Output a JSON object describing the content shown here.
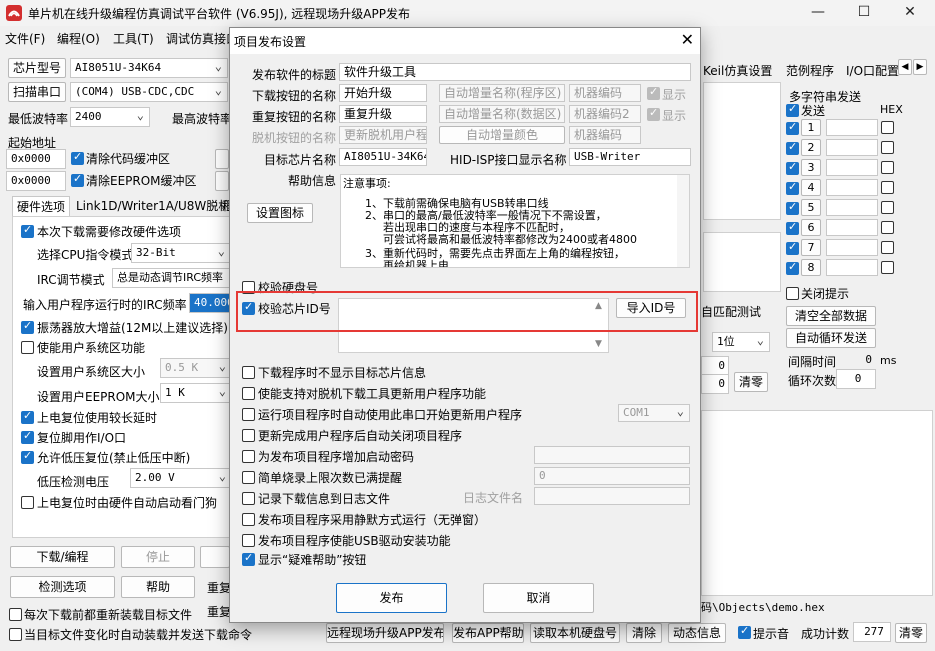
{
  "window": {
    "title": "单片机在线升级编程仿真调试平台软件 (V6.95J), 远程现场升级APP发布",
    "controls": [
      "—",
      "☐",
      "✕"
    ]
  },
  "menu": [
    "文件(F)",
    "编程(O)",
    "工具(T)",
    "调试仿真接口"
  ],
  "left": {
    "chip_type_btn": "芯片型号",
    "chip_type_val": "AI8051U-34K64",
    "scan_port_btn": "扫描串口",
    "port_val": "(COM4) USB-CDC,CDC",
    "min_baud_label": "最低波特率",
    "min_baud_val": "2400",
    "max_baud_label": "最高波特率",
    "start_addr_label": "起始地址",
    "addr1": "0x0000",
    "clear_code_buf": "清除代码缓冲区",
    "addr2": "0x0000",
    "clear_eeprom_buf": "清除EEPROM缓冲区",
    "tabs": [
      "硬件选项",
      "Link1D/Writer1A/U8W脱机",
      "程"
    ],
    "options": {
      "modify_hw": "本次下载需要修改硬件选项",
      "cpu_mode_label": "选择CPU指令模式",
      "cpu_mode_val": "32-Bit",
      "irc_mode_label": "IRC调节模式",
      "irc_mode_val": "总是动态调节IRC频率",
      "irc_freq_label": "输入用户程序运行时的IRC频率",
      "irc_freq_val": "40.000",
      "osc_gain": "振荡器放大增益(12M以上建议选择)",
      "enable_user_sys": "使能用户系统区功能",
      "user_sys_size_label": "设置用户系统区大小",
      "user_sys_size_val": "0.5 K",
      "user_eeprom_label": "设置用户EEPROM大小",
      "user_eeprom_val": "1   K",
      "long_reset": "上电复位使用较长延时",
      "reset_io": "复位脚用作I/O口",
      "lvr": "允许低压复位(禁止低压中断)",
      "lvd_label": "低压检测电压",
      "lvd_val": "2.00 V",
      "hw_auto_start": "上电复位时由硬件自动启动看门狗"
    },
    "download_btn": "下载/编程",
    "stop_btn": "停止",
    "check_btn": "检测选项",
    "help_btn": "帮助",
    "reload_label": "重复",
    "reload_label2": "重复",
    "reload_each": "每次下载前都重新装载目标文件",
    "auto_send": "当目标文件变化时自动装载并发送下载命令"
  },
  "right": {
    "tabs": [
      "Keil仿真设置",
      "范例程序",
      "I/O口配置"
    ],
    "multi_send_title": "多字符串发送",
    "send_label": "发送",
    "hex_label": "HEX",
    "rows": [
      "1",
      "2",
      "3",
      "4",
      "5",
      "6",
      "7",
      "8"
    ],
    "close_tip": "关闭提示",
    "clear_all": "清空全部数据",
    "auto_loop": "自动循环发送",
    "interval_label": "间隔时间",
    "interval_val": "0",
    "interval_unit": "ms",
    "loop_count_label": "循环次数",
    "loop_count_val": "0",
    "match_test": "自匹配测试",
    "one_bit": "1位",
    "zero1": "0",
    "zero2": "0",
    "clear": "清零",
    "hex_path": "码\\Objects\\demo.hex"
  },
  "bottom": {
    "remote_app_btn": "远程现场升级APP发布",
    "app_help_btn": "发布APP帮助",
    "read_disk_btn": "读取本机硬盘号",
    "clear_btn": "清除",
    "dynamic_btn": "动态信息",
    "beep": "提示音",
    "success_label": "成功计数",
    "success_count": "277",
    "clear_count": "清零"
  },
  "dialog": {
    "title": "项目发布设置",
    "close": "✕",
    "fields": {
      "software_title_label": "发布软件的标题",
      "software_title_val": "软件升级工具",
      "download_name_label": "下载按钮的名称",
      "download_name_val": "开始升级",
      "auto_inc_prog": "自动增量名称(程序区)",
      "code1": "机器编码",
      "show1": "显示",
      "repeat_name_label": "重复按钮的名称",
      "repeat_name_val": "重复升级",
      "auto_inc_data": "自动增量名称(数据区)",
      "code2": "机器编码2",
      "show2": "显示",
      "offline_name_label": "脱机按钮的名称",
      "offline_name_val": "更新脱机用户程",
      "auto_inc_color": "自动增量颜色",
      "code3": "机器编码",
      "target_chip_label": "目标芯片名称",
      "target_chip_val": "AI8051U-34K64",
      "hid_label": "HID-ISP接口显示名称",
      "hid_val": "USB-Writer",
      "help_label": "帮助信息",
      "set_icon_btn": "设置图标"
    },
    "help_text": [
      "注意事项:",
      "1、下载前需确保电脑有USB转串口线",
      "2、串口的最高/最低波特率一般情况下不需设置，",
      "若出现串口的速度与本程序不匹配时，",
      "可尝试将最高和最低波特率都修改为2400或者4800",
      "3、重新代码时，需要先点击界面左上角的编程按钮，",
      "再给机器上电"
    ],
    "verify_disk": "校验硬盘号",
    "verify_chip_id": "校验芯片ID号",
    "import_id_btn": "导入ID号",
    "options": [
      "下载程序时不显示目标芯片信息",
      "使能支持对脱机下载工具更新用户程序功能",
      "运行项目程序时自动使用此串口开始更新用户程序",
      "更新完成用户程序后自动关闭项目程序",
      "为发布项目程序增加启动密码",
      "简单烧录上限次数已满提醒",
      "记录下载信息到日志文件",
      "发布项目程序采用静默方式运行（无弹窗）",
      "发布项目程序使能USB驱动安装功能",
      "显示“疑难帮助”按钮"
    ],
    "com_val": "COM1",
    "limit_val": "0",
    "log_label": "日志文件名",
    "publish_btn": "发布",
    "cancel_btn": "取消"
  },
  "colors": {
    "accent": "#1a73c8",
    "highlight_border": "#e53935"
  }
}
